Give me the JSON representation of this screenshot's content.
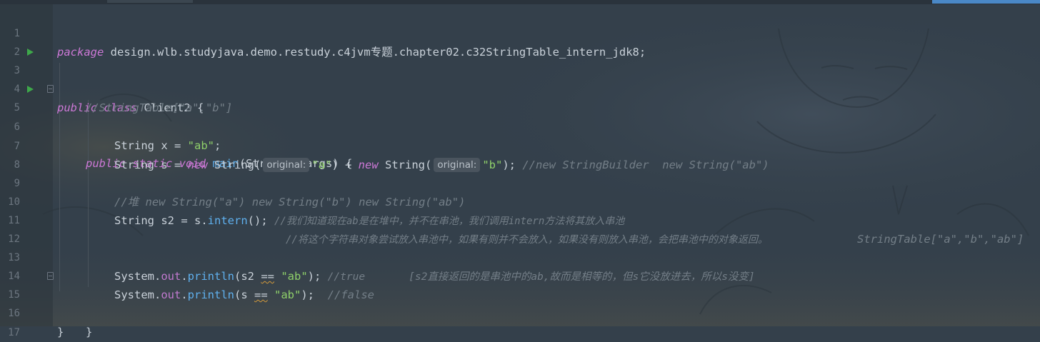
{
  "editor": {
    "line_numbers": [
      "1",
      "2",
      "3",
      "4",
      "5",
      "6",
      "7",
      "8",
      "9",
      "10",
      "11",
      "12",
      "13",
      "14",
      "15",
      "16",
      "17"
    ],
    "lines": {
      "l1": {
        "kw": "package",
        "rest": " design.wlb.studyjava.demo.restudy.c4jvm专题.chapter02.c32StringTable_intern_jdk8;"
      },
      "l3": {
        "kw1": "public",
        "kw2": "class",
        "rest": " Client2 {"
      },
      "l4": {
        "comment": "//StringTable[\"a\",\"b\"]"
      },
      "l5": {
        "kw1": "public",
        "kw2": "static",
        "kw3": "void",
        "method": "main",
        "rest": "(String[] args) {"
      },
      "l6": {
        "pre": "String x = ",
        "str": "\"ab\"",
        "post": ";"
      },
      "l7": {
        "pre": "String s = ",
        "new1": "new",
        "mid1": " String(",
        "hint1": "original:",
        "str1": "\"a\"",
        "plus": ") + ",
        "new2": "new",
        "mid2": " String(",
        "hint2": "original:",
        "str2": "\"b\"",
        "post": "); ",
        "comment": "//new StringBuilder  new String(\"ab\")"
      },
      "l9": {
        "comment": "//堆 new String(\"a\") new String(\"b\") new String(\"ab\")"
      },
      "l10": {
        "pre": "String s2 = s.",
        "method": "intern",
        "post": "(); ",
        "comment": "//我们知道现在ab是在堆中，并不在串池，我们调用intern方法将其放入串池",
        "right_comment": "StringTable[\"a\",\"b\",\"ab\"]"
      },
      "l11": {
        "comment": "//将这个字符串对象尝试放入串池中，如果有则并不会放入，如果没有则放入串池，会把串池中的对象返回。"
      },
      "l13": {
        "pre": "System.",
        "field": "out",
        "dot": ".",
        "method": "println",
        "args1": "(s2 ",
        "op": "==",
        "sp": " ",
        "str": "\"ab\"",
        "post": "); ",
        "comment": "//true       [s2直接返回的是串池中的ab,故而是相等的，但s它没放进去，所以s没变]"
      },
      "l14": {
        "pre": "System.",
        "field": "out",
        "dot": ".",
        "method": "println",
        "args1": "(s ",
        "op": "==",
        "sp": " ",
        "str": "\"ab\"",
        "post": ");  ",
        "comment": "//false"
      },
      "l15": {
        "text": "}"
      },
      "l16": {
        "text": "}"
      }
    }
  },
  "colors": {
    "background": "#34404b",
    "keyword": "#cc78d6",
    "string": "#8fd06a",
    "method": "#5fb0ee",
    "comment": "#737e87",
    "run_icon": "#3ea84a"
  }
}
